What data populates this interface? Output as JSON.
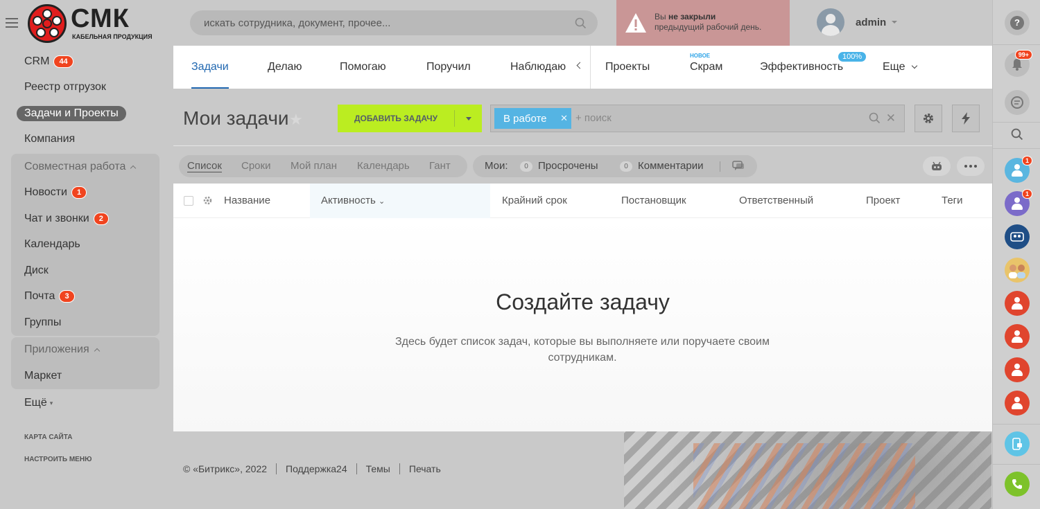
{
  "logo": {
    "title": "СМК",
    "subtitle": "КАБЕЛЬНАЯ ПРОДУКЦИЯ"
  },
  "sidebar": {
    "items": [
      {
        "label": "CRM",
        "badge": "44"
      },
      {
        "label": "Реестр отгрузок"
      },
      {
        "label": "Задачи и Проекты"
      },
      {
        "label": "Компания"
      },
      {
        "label": "Совместная работа"
      },
      {
        "label": "Новости",
        "badge": "1"
      },
      {
        "label": "Чат и звонки",
        "badge": "2"
      },
      {
        "label": "Календарь"
      },
      {
        "label": "Диск"
      },
      {
        "label": "Почта",
        "badge": "3"
      },
      {
        "label": "Группы"
      },
      {
        "label": "Приложения"
      },
      {
        "label": "Маркет"
      },
      {
        "label": "Ещё"
      }
    ],
    "sitemap": "КАРТА САЙТА",
    "configure_menu": "НАСТРОИТЬ МЕНЮ"
  },
  "search": {
    "placeholder": "искать сотрудника, документ, прочее..."
  },
  "warning": {
    "line1_prefix": "Вы ",
    "line1_bold": "не закрыли",
    "line2": "предыдущий рабочий день."
  },
  "user": {
    "name": "admin"
  },
  "tabs": {
    "items": [
      "Задачи",
      "Делаю",
      "Помогаю",
      "Поручил",
      "Наблюдаю",
      "Проекты",
      "Скрам",
      "Эффективность",
      "Еще"
    ],
    "new_tag": "НОВОЕ",
    "efficiency_badge": "100%"
  },
  "page": {
    "title": "Мои задачи"
  },
  "add_task": {
    "label": "ДОБАВИТЬ ЗАДАЧУ"
  },
  "filter": {
    "chip": "В работе",
    "placeholder": "+ поиск"
  },
  "views": [
    "Список",
    "Сроки",
    "Мой план",
    "Календарь",
    "Гант"
  ],
  "counters": {
    "label": "Мои:",
    "overdue_count": "0",
    "overdue": "Просрочены",
    "comments_count": "0",
    "comments": "Комментарии"
  },
  "table": {
    "columns": [
      "Название",
      "Активность",
      "Крайний срок",
      "Постановщик",
      "Ответственный",
      "Проект",
      "Теги"
    ]
  },
  "empty": {
    "title": "Создайте задачу",
    "subtitle": "Здесь будет список задач, которые вы выполняете или поручаете своим сотрудникам."
  },
  "footer": [
    "© «Битрикс», 2022",
    "Поддержка24",
    "Темы",
    "Печать"
  ],
  "right_bar": {
    "notifications_badge": "99+",
    "user1_badge": "1",
    "user2_badge": "1"
  },
  "colors": {
    "accent": "#2067b0",
    "add_button": "#bbed21",
    "badge": "#f0441f",
    "chip": "#55b4e3"
  }
}
